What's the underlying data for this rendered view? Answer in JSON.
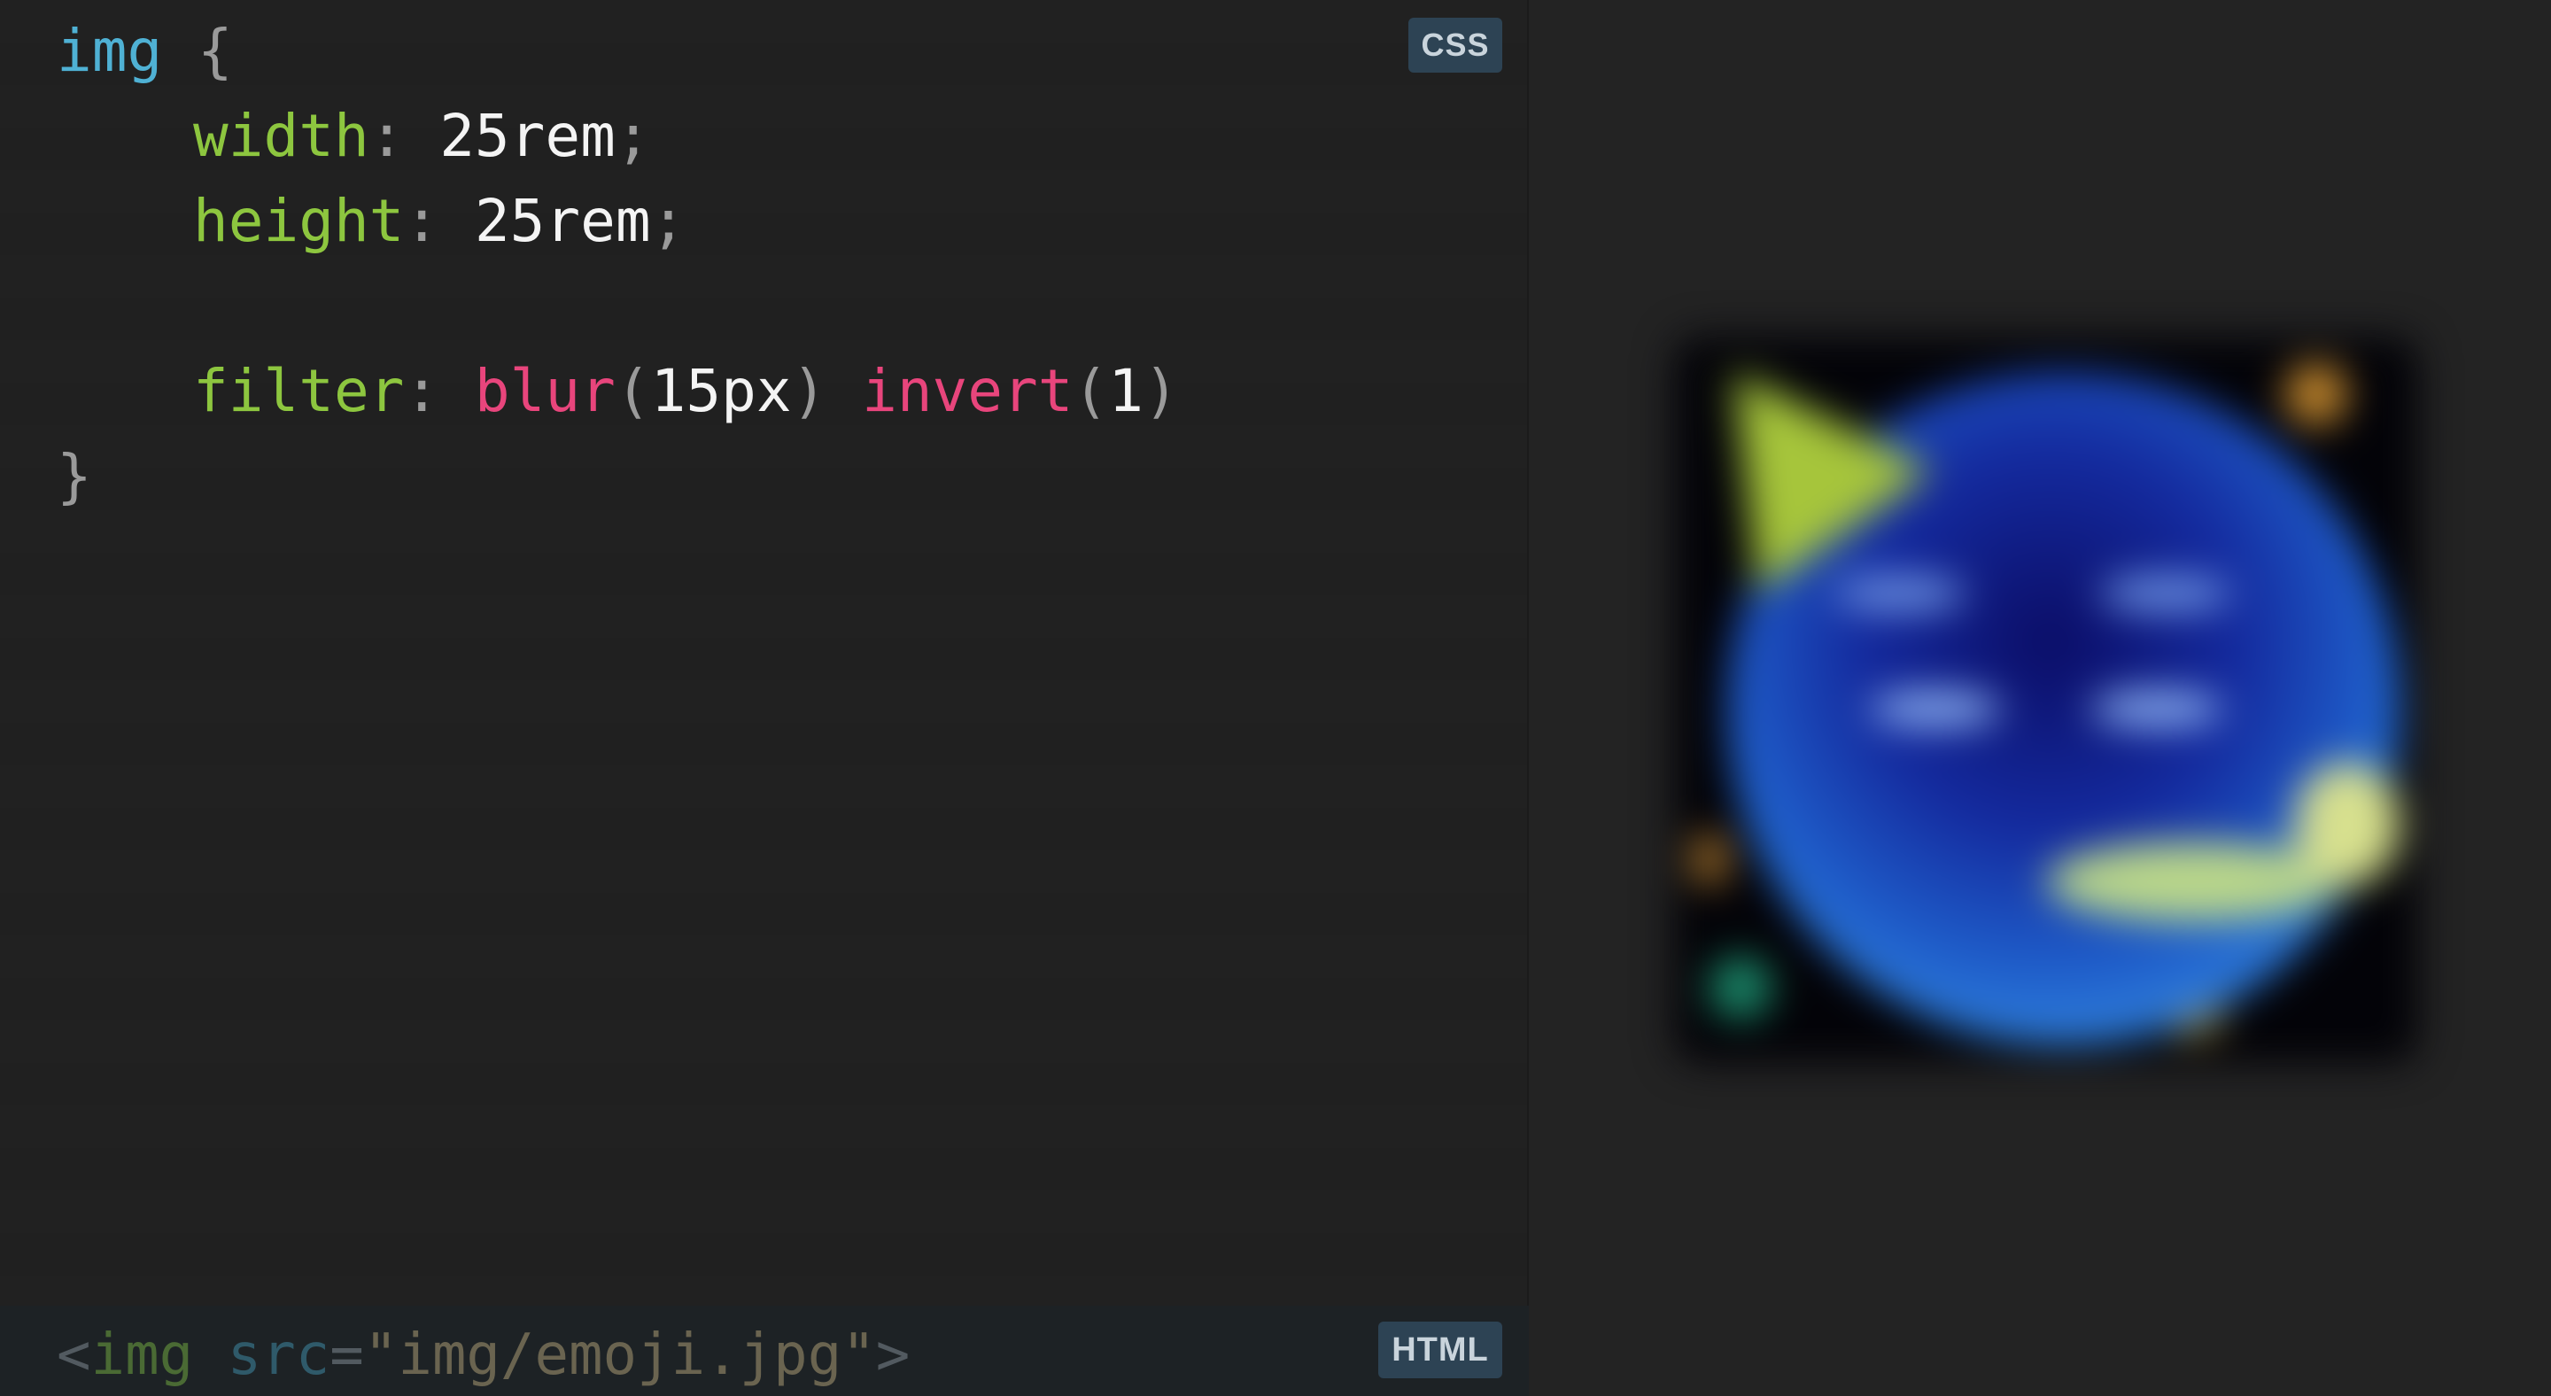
{
  "css_panel": {
    "badge": "CSS",
    "code": {
      "selector": "img",
      "open_brace": "{",
      "close_brace": "}",
      "declarations": [
        {
          "property": "width",
          "colon": ":",
          "value": "25rem",
          "semicolon": ";"
        },
        {
          "property": "height",
          "colon": ":",
          "value": "25rem",
          "semicolon": ";"
        }
      ],
      "filter": {
        "property": "filter",
        "colon": ":",
        "func1": "blur",
        "arg1": "15px",
        "func2": "invert",
        "arg2": "1",
        "open_paren": "(",
        "close_paren": ")"
      }
    }
  },
  "html_panel": {
    "badge": "HTML",
    "lt": "<",
    "tag": "img",
    "attr": "src",
    "eq": "=",
    "quote": "\"",
    "value": "img/emoji.jpg",
    "gt": ">"
  },
  "preview": {
    "image_icon": "emoji-image",
    "colors": {
      "face": "#1f5fcb",
      "hat": "#a6c53b",
      "background": "#030308"
    }
  }
}
